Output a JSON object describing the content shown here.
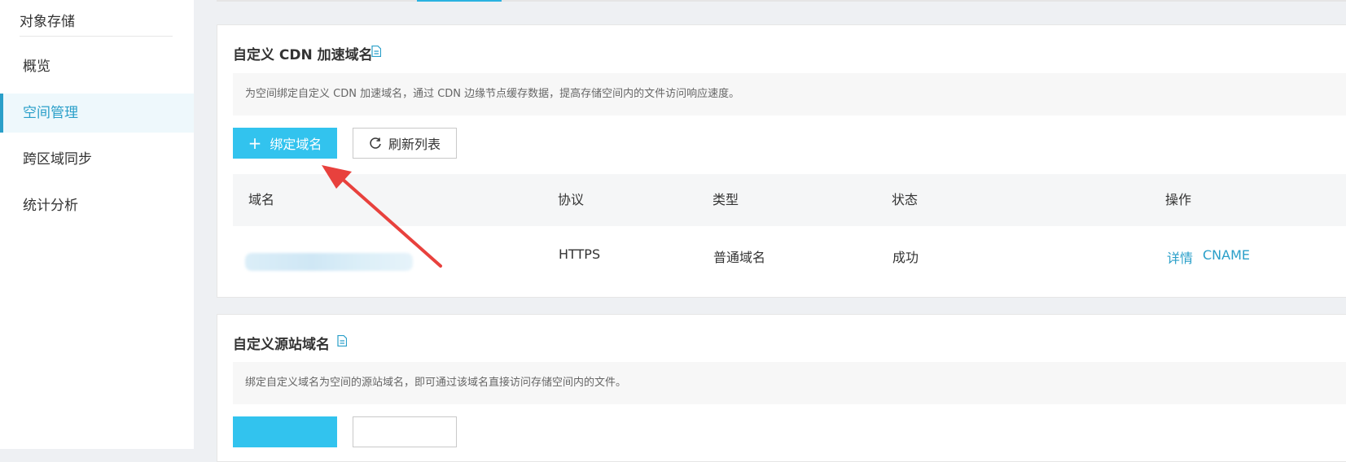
{
  "sidebar": {
    "title": "对象存储",
    "items": [
      {
        "label": "概览",
        "active": false
      },
      {
        "label": "空间管理",
        "active": true
      },
      {
        "label": "跨区域同步",
        "active": false
      },
      {
        "label": "统计分析",
        "active": false
      }
    ]
  },
  "cdn_card": {
    "title": "自定义 CDN 加速域名",
    "description": "为空间绑定自定义 CDN 加速域名，通过 CDN 边缘节点缓存数据，提高存储空间内的文件访问响应速度。",
    "bind_button": "绑定域名",
    "refresh_button": "刷新列表",
    "columns": [
      "域名",
      "协议",
      "类型",
      "状态",
      "操作"
    ],
    "rows": [
      {
        "protocol": "HTTPS",
        "type": "普通域名",
        "status": "成功",
        "actions": [
          "详情",
          "CNAME"
        ]
      }
    ]
  },
  "origin_card": {
    "title": "自定义源站域名",
    "description": "绑定自定义域名为空间的源站域名，即可通过该域名直接访问存储空间内的文件。"
  },
  "colors": {
    "accent": "#32c3ee",
    "link": "#2a9fc9",
    "arrow": "#e8413d"
  },
  "icons": [
    "doc-icon",
    "plus-icon",
    "refresh-icon",
    "arrow-annotation"
  ]
}
